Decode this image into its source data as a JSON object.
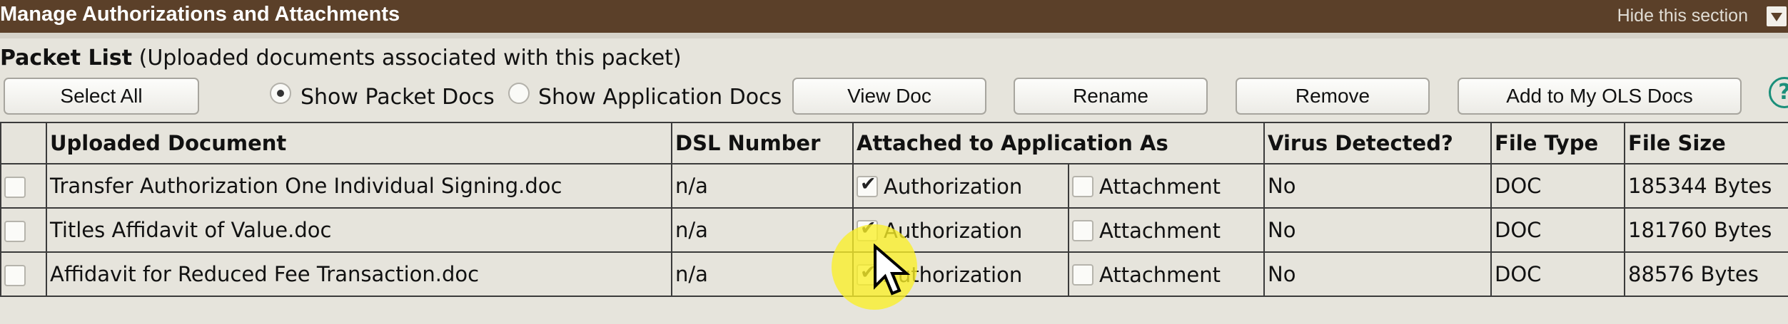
{
  "header": {
    "title": "Manage Authorizations and Attachments",
    "hide_label": "Hide this section"
  },
  "packet_list": {
    "title": "Packet List",
    "subtitle": " (Uploaded documents associated with this packet)"
  },
  "toolbar": {
    "select_all": "Select All",
    "show_packet_docs": "Show Packet Docs",
    "show_application_docs": "Show Application Docs",
    "view_doc": "View Doc",
    "rename": "Rename",
    "remove": "Remove",
    "add_to_my_ols_docs": "Add to My OLS Docs",
    "help": "?"
  },
  "table": {
    "headers": [
      "Uploaded Document",
      "DSL Number",
      "Attached to Application As",
      "Virus Detected?",
      "File Type",
      "File Size"
    ],
    "rows": [
      {
        "name": "Transfer Authorization One Individual Signing.doc",
        "dsl": "n/a",
        "authorization": "Authorization",
        "attachment": "Attachment",
        "virus": "No",
        "type": "DOC",
        "size": "185344 Bytes",
        "auth_checked": true,
        "attach_checked": false
      },
      {
        "name": "Titles Affidavit of Value.doc",
        "dsl": "n/a",
        "authorization": "Authorization",
        "attachment": "Attachment",
        "virus": "No",
        "type": "DOC",
        "size": "181760 Bytes",
        "auth_checked": true,
        "attach_checked": false
      },
      {
        "name": "Affidavit for Reduced Fee Transaction.doc",
        "dsl": "n/a",
        "authorization": "Authorization",
        "attachment": "Attachment",
        "virus": "No",
        "type": "DOC",
        "size": "88576 Bytes",
        "auth_checked": true,
        "attach_checked": false
      }
    ]
  },
  "colors": {
    "header_bg": "#5b4029",
    "page_bg": "#e6e4dc",
    "cursor_highlight": "#faf028"
  }
}
